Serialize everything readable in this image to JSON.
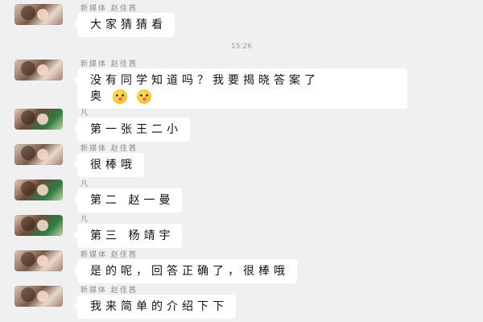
{
  "timestamp": "15:26",
  "messages": [
    {
      "sender": "新媒体 赵佳茜",
      "text": "大家猜猜看"
    },
    {
      "sender": "新媒体 赵佳茜",
      "text": "没有同学知道吗？我要揭晓答案了",
      "text2": "奥",
      "emojis": [
        "blush-kiss-emoji",
        "blush-kiss-emoji"
      ]
    },
    {
      "sender": "凡",
      "text": "第一张王二小"
    },
    {
      "sender": "新媒体 赵佳茜",
      "text": "很棒哦"
    },
    {
      "sender": "凡",
      "text": "第二 赵一曼"
    },
    {
      "sender": "凡",
      "text": "第三 杨靖宇"
    },
    {
      "sender": "新媒体 赵佳茜",
      "text": "是的呢，回答正确了，很棒哦"
    },
    {
      "sender": "新媒体 赵佳茜",
      "text": "我来简单的介绍下下"
    }
  ]
}
